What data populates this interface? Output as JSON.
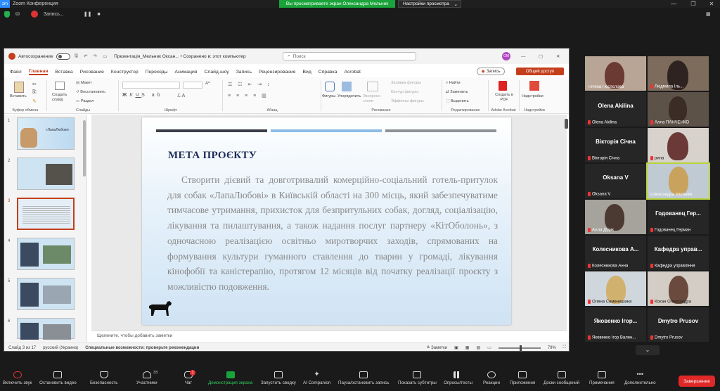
{
  "zoom": {
    "window_title": "Zoom Конференция",
    "sharing_banner": "Вы просматриваете экран Олександра Мельник",
    "view_settings": "Настройки просмотра",
    "recording": "Запись...",
    "end_button": "Завершение"
  },
  "ppt": {
    "autosave": "Автосохранение",
    "doc_title": "Презентація_Мельник Оксан... • Сохранено в: этот компьютер",
    "search_placeholder": "Поиск",
    "avatar_initials": "ОМ",
    "menu": [
      "Файл",
      "Главная",
      "Вставка",
      "Рисование",
      "Конструктор",
      "Переходы",
      "Анимация",
      "Слайд-шоу",
      "Запись",
      "Рецензирование",
      "Вид",
      "Справка",
      "Acrobat"
    ],
    "active_menu": "Главная",
    "record_button": "Запись",
    "share_button": "Общий доступ",
    "ribbon": {
      "paste": "Вставить",
      "clipboard": "Буфер обмена",
      "new_slide": "Создать слайд",
      "layout": "Макет",
      "reset": "Восстановить",
      "section": "Раздел",
      "slides": "Слайды",
      "font": "Шрифт",
      "paragraph": "Абзац",
      "shapes": "Фигуры",
      "arrange": "Упорядочить",
      "quick_styles": "Экспресс-стили",
      "fill": "Заливка фигуры",
      "outline": "Контур фигуры",
      "effects": "Эффекты фигуры",
      "drawing": "Рисование",
      "find": "Найти",
      "replace": "Заменить",
      "select": "Выделить",
      "editing": "Редактирование",
      "create_pdf": "Создать в PDF",
      "acrobat": "Adobe Acrobat",
      "addins": "Надстройки",
      "addins_group": "Надстройки"
    },
    "slide": {
      "title": "МЕТА ПРОЄКТУ",
      "body": "Створити дієвий та довготривалий комерційно-соціальний готель-притулок для собак «ЛапаЛюбові» в Київській області на 300 місць, який забезпечуватиме тимчасове утримання, прихисток для безпритульних собак,  догляд, соціалізацію, лікування та пилаштування, а також надання послуг партнеру «КітОболонь», з одночасною реалізацією освітньо миротворчих заходів, спрямованих на формування культури гуманного ставлення до тварин у громаді, лікування кінофобії та каністерапію, протягом 12 місяців від початку реалізації проєкту з можливістю подовження."
    },
    "thumb1_title": "«ЛапаЛюбові»",
    "thumb_numbers": [
      "1",
      "2",
      "3",
      "4",
      "5",
      "6"
    ],
    "notes_placeholder": "Щелкните, чтобы добавить заметки",
    "status": {
      "slide": "Слайд 3 из 17",
      "language": "русский (Украина)",
      "accessibility": "Специальные возможности: проверьте рекомендации",
      "notes": "Заметки",
      "zoom": "79%"
    }
  },
  "participants": [
    {
      "name": "Тетяна Поспєлова",
      "muted": false,
      "video": true
    },
    {
      "name": "Людмила Іль...",
      "muted": true,
      "video": true
    },
    {
      "name": "Olena Akilina",
      "display": "Olena Akilina",
      "muted": true,
      "video": false
    },
    {
      "name": "Алла ПАНЧЕНКО",
      "muted": true,
      "video": true
    },
    {
      "name": "Вікторія Січна",
      "display": "Вікторія Січна",
      "muted": true,
      "video": false
    },
    {
      "name": "рина",
      "muted": true,
      "video": true
    },
    {
      "name": "Oksana V",
      "display": "Oksana V",
      "muted": true,
      "video": false
    },
    {
      "name": "Олександра Мельник",
      "muted": false,
      "video": true,
      "speaking": true
    },
    {
      "name": "Алла Дідик",
      "muted": true,
      "video": true
    },
    {
      "name": "Годованец Герман",
      "display": "Годованец Гер...",
      "muted": true,
      "video": false
    },
    {
      "name": "Колесникова Анна",
      "display": "Колесникова А...",
      "muted": true,
      "video": false
    },
    {
      "name": "Кафедра управління",
      "display": "Кафедра управ...",
      "muted": true,
      "video": false
    },
    {
      "name": "Олена Семенишина",
      "muted": true,
      "video": true
    },
    {
      "name": "Кохан Олександра",
      "muted": true,
      "video": true
    },
    {
      "name": "Яковенко Ігор Вален...",
      "display": "Яковенко Ігор...",
      "muted": true,
      "video": false
    },
    {
      "name": "Dmytro Prusov",
      "display": "Dmytro Prusov",
      "muted": true,
      "video": false
    }
  ],
  "toolbar": [
    {
      "label": "Включить звук"
    },
    {
      "label": "Остановить видео"
    },
    {
      "label": "Безопасность"
    },
    {
      "label": "Участники",
      "count": "33"
    },
    {
      "label": "Чат",
      "badge": "1"
    },
    {
      "label": "Демонстрация экрана"
    },
    {
      "label": "Запустить сводку"
    },
    {
      "label": "AI Companion"
    },
    {
      "label": "Пауза/остановить запись"
    },
    {
      "label": "Показать субтитры"
    },
    {
      "label": "Опросы/тесты"
    },
    {
      "label": "Реакции"
    },
    {
      "label": "Приложения"
    },
    {
      "label": "Доски сообщений"
    },
    {
      "label": "Примечания"
    },
    {
      "label": "Дополнительно"
    }
  ],
  "colors": {
    "zoom_green": "#1aa33a",
    "ppt_accent": "#c43e1c",
    "slide_title": "#1d2d57",
    "speaking": "#b9d33a",
    "end": "#e02828"
  }
}
